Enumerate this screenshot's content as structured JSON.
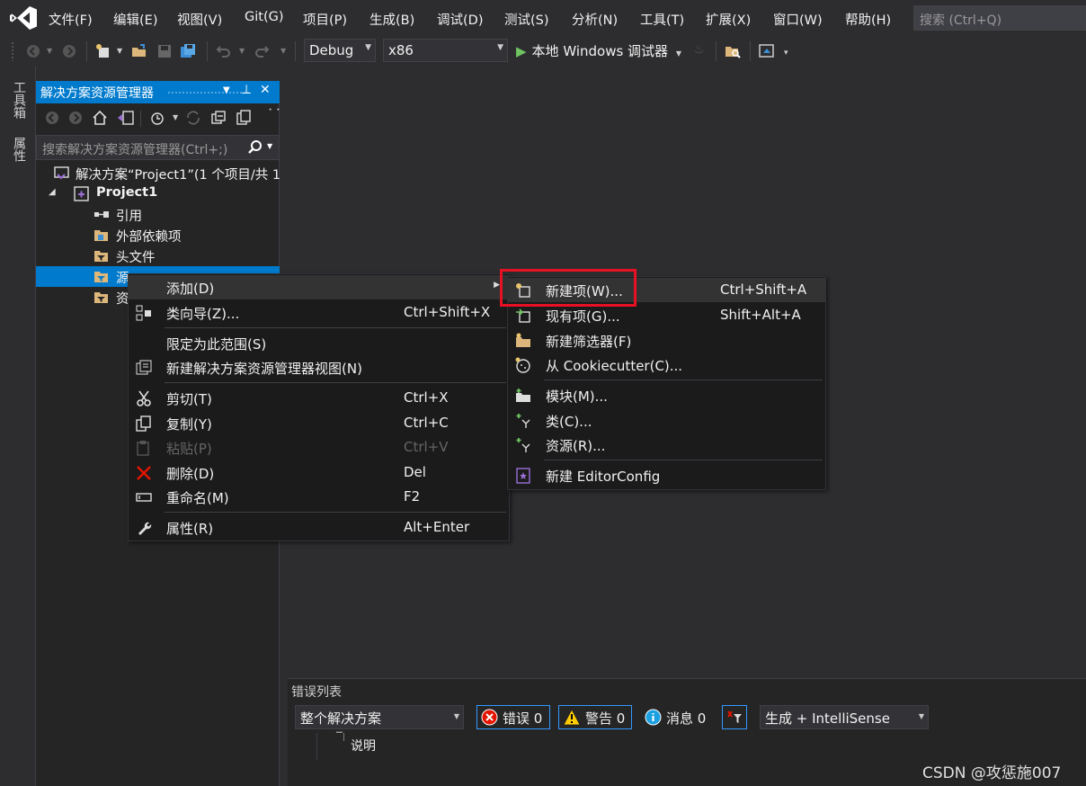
{
  "menubar": {
    "items": [
      "文件(F)",
      "编辑(E)",
      "视图(V)",
      "Git(G)",
      "项目(P)",
      "生成(B)",
      "调试(D)",
      "测试(S)",
      "分析(N)",
      "工具(T)",
      "扩展(X)",
      "窗口(W)",
      "帮助(H)"
    ],
    "search_placeholder": "搜索 (Ctrl+Q)"
  },
  "toolbar": {
    "config": "Debug",
    "platform": "x86",
    "run_label": "本地 Windows 调试器"
  },
  "left_tabs": [
    "工具箱",
    "属性"
  ],
  "solution_explorer": {
    "title": "解决方案资源管理器",
    "search_placeholder": "搜索解决方案资源管理器(Ctrl+;)",
    "tree": [
      {
        "label": "解决方案“Project1”(1 个项目/共 1",
        "icon": "solution-icon"
      },
      {
        "label": "Project1",
        "icon": "project-icon",
        "expander": "◢"
      },
      {
        "label": "引用",
        "icon": "references-icon"
      },
      {
        "label": "外部依赖项",
        "icon": "external-deps-icon"
      },
      {
        "label": "头文件",
        "icon": "folder-icon"
      },
      {
        "label": "源",
        "icon": "folder-icon",
        "selected": true
      },
      {
        "label": "资",
        "icon": "folder-icon"
      }
    ]
  },
  "context_menu": {
    "items": [
      {
        "label": "添加(D)",
        "shortcut": "",
        "icon": "",
        "submenu": true,
        "highlighted": true
      },
      {
        "label": "类向导(Z)...",
        "shortcut": "Ctrl+Shift+X",
        "icon": "class-wizard-icon"
      },
      {
        "label": "限定为此范围(S)",
        "shortcut": "",
        "icon": ""
      },
      {
        "label": "新建解决方案资源管理器视图(N)",
        "shortcut": "",
        "icon": "new-view-icon"
      },
      {
        "label": "剪切(T)",
        "shortcut": "Ctrl+X",
        "icon": "cut-icon"
      },
      {
        "label": "复制(Y)",
        "shortcut": "Ctrl+C",
        "icon": "copy-icon"
      },
      {
        "label": "粘贴(P)",
        "shortcut": "Ctrl+V",
        "icon": "paste-icon",
        "disabled": true
      },
      {
        "label": "删除(D)",
        "shortcut": "Del",
        "icon": "delete-icon"
      },
      {
        "label": "重命名(M)",
        "shortcut": "F2",
        "icon": "rename-icon"
      },
      {
        "label": "属性(R)",
        "shortcut": "Alt+Enter",
        "icon": "wrench-icon"
      }
    ]
  },
  "submenu": {
    "items": [
      {
        "label": "新建项(W)...",
        "shortcut": "Ctrl+Shift+A",
        "icon": "new-item-icon",
        "highlighted": true
      },
      {
        "label": "现有项(G)...",
        "shortcut": "Shift+Alt+A",
        "icon": "existing-item-icon"
      },
      {
        "label": "新建筛选器(F)",
        "shortcut": "",
        "icon": "new-filter-icon"
      },
      {
        "label": "从 Cookiecutter(C)...",
        "shortcut": "",
        "icon": "cookiecutter-icon"
      },
      {
        "label": "模块(M)...",
        "shortcut": "",
        "icon": "module-icon"
      },
      {
        "label": "类(C)...",
        "shortcut": "",
        "icon": "class-icon"
      },
      {
        "label": "资源(R)...",
        "shortcut": "",
        "icon": "resource-icon"
      },
      {
        "label": "新建 EditorConfig",
        "shortcut": "",
        "icon": "editorconfig-icon"
      }
    ]
  },
  "error_list": {
    "title": "错误列表",
    "scope": "整个解决方案",
    "errors": "错误 0",
    "warnings": "警告 0",
    "messages": "消息 0",
    "build_filter": "生成 + IntelliSense",
    "column_description": "说明"
  },
  "watermark": "CSDN @攻惩施007",
  "colors": {
    "accent": "#007acc",
    "highlight_box": "#e81123",
    "error": "#e51400",
    "warning": "#ffcc00",
    "info": "#1ba1e2"
  }
}
